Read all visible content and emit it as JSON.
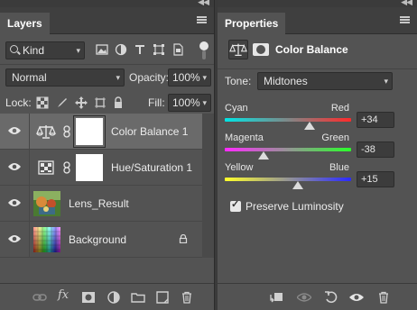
{
  "layers_panel": {
    "tab_label": "Layers",
    "filter": {
      "kind_label": "Kind"
    },
    "blend_mode": "Normal",
    "opacity_label": "Opacity:",
    "opacity_value": "100%",
    "lock_label": "Lock:",
    "fill_label": "Fill:",
    "fill_value": "100%",
    "layers": [
      {
        "name": "Color Balance 1",
        "type": "adjustment",
        "icon": "color-balance-icon",
        "selected": true
      },
      {
        "name": "Hue/Saturation 1",
        "type": "adjustment",
        "icon": "hue-saturation-icon",
        "selected": false
      },
      {
        "name": "Lens_Result",
        "type": "image",
        "selected": false
      },
      {
        "name": "Background",
        "type": "image",
        "locked": true,
        "selected": false
      }
    ],
    "bottom_icons": [
      "link-icon",
      "fx-icon",
      "add-mask-icon",
      "new-adjustment-icon",
      "new-group-icon",
      "new-layer-icon",
      "trash-icon"
    ],
    "fx_label": "fx"
  },
  "properties_panel": {
    "tab_label": "Properties",
    "title": "Color Balance",
    "tone_label": "Tone:",
    "tone_value": "Midtones",
    "sliders": [
      {
        "left": "Cyan",
        "right": "Red",
        "value": "+34",
        "level": 34,
        "colors": [
          "#00e5e5",
          "#ff2a2a"
        ]
      },
      {
        "left": "Magenta",
        "right": "Green",
        "value": "-38",
        "level": -38,
        "colors": [
          "#ff2aff",
          "#2aff2a"
        ]
      },
      {
        "left": "Yellow",
        "right": "Blue",
        "value": "+15",
        "level": 15,
        "colors": [
          "#ffff2a",
          "#2a2aff"
        ]
      }
    ],
    "preserve_luminosity_label": "Preserve Luminosity",
    "preserve_luminosity_checked": true,
    "bottom_icons": [
      "clip-to-layer-icon",
      "view-previous-icon",
      "reset-icon",
      "visibility-icon",
      "trash-icon"
    ]
  },
  "colors": {
    "panel_bg": "#535353",
    "selected_row": "#6a6a6a",
    "field_bg": "#3c3c3c"
  }
}
